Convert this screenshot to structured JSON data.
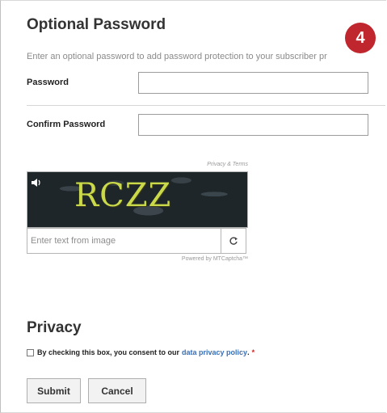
{
  "section": {
    "title": "Optional Password",
    "subtitle": "Enter an optional password to add password protection to your subscriber pr",
    "step_badge": "4"
  },
  "fields": {
    "password_label": "Password",
    "password_value": "",
    "confirm_label": "Confirm Password",
    "confirm_value": ""
  },
  "captcha": {
    "terms_link": "Privacy & Terms",
    "image_text": "RCZZ",
    "input_placeholder": "Enter text from image",
    "powered_by": "Powered by MTCaptcha™",
    "audio_icon": "speaker-icon",
    "refresh_icon": "refresh-icon"
  },
  "privacy": {
    "title": "Privacy",
    "consent_text": "By checking this box, you consent to our",
    "consent_link": "data privacy policy",
    "consent_period": ".",
    "required_marker": "*"
  },
  "buttons": {
    "submit": "Submit",
    "cancel": "Cancel"
  },
  "colors": {
    "badge": "#c0262d",
    "link": "#3a6fb5",
    "required": "#d62020"
  }
}
